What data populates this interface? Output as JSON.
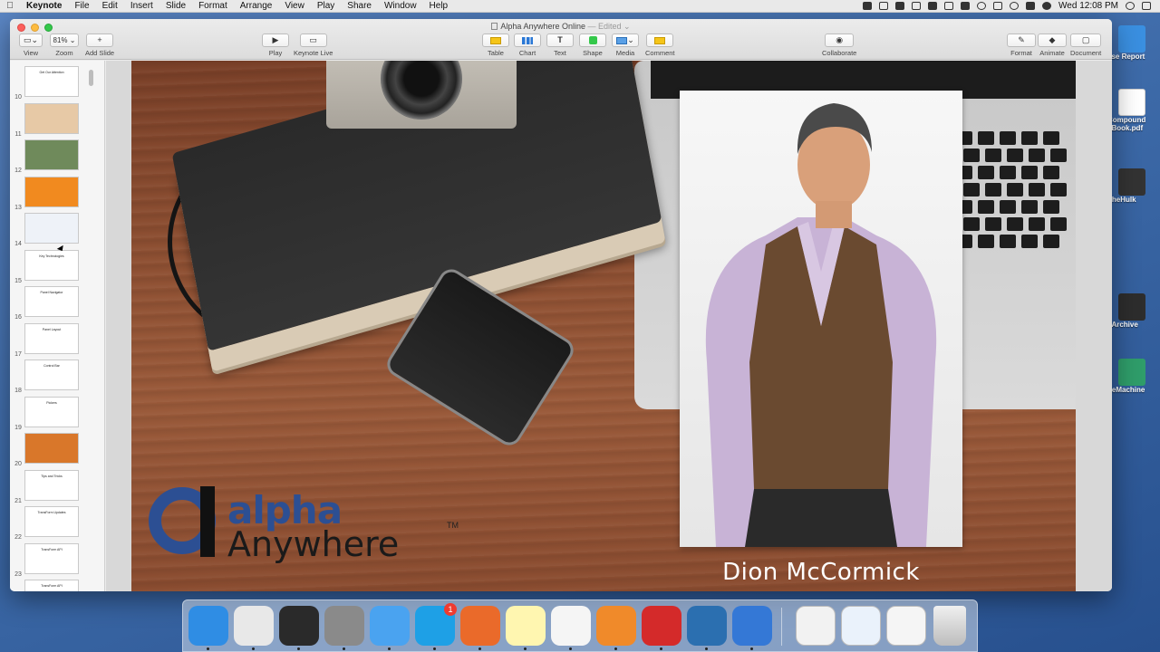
{
  "menubar": {
    "app": "Keynote",
    "items": [
      "File",
      "Edit",
      "Insert",
      "Slide",
      "Format",
      "Arrange",
      "View",
      "Play",
      "Share",
      "Window",
      "Help"
    ],
    "clock": "Wed 12:08 PM"
  },
  "window": {
    "title": "Alpha Anywhere Online",
    "status": "— Edited ⌄"
  },
  "toolbar": {
    "view": "View",
    "zoom_value": "81% ⌄",
    "zoom": "Zoom",
    "add_slide": "Add Slide",
    "play": "Play",
    "keynote_live": "Keynote Live",
    "table": "Table",
    "chart": "Chart",
    "text": "Text",
    "shape": "Shape",
    "media": "Media",
    "comment": "Comment",
    "collaborate": "Collaborate",
    "format": "Format",
    "animate": "Animate",
    "document": "Document"
  },
  "navigator": {
    "slides": [
      {
        "num": "10",
        "title": "Get Our Attention",
        "color": "#ffffff"
      },
      {
        "num": "11",
        "title": "",
        "color": "#e7c9a6"
      },
      {
        "num": "12",
        "title": "",
        "color": "#6f8a5b"
      },
      {
        "num": "13",
        "title": "",
        "color": "#f18a1f"
      },
      {
        "num": "14",
        "title": "",
        "color": "#eef2f8"
      },
      {
        "num": "15",
        "title": "Key Technologies",
        "color": "#ffffff"
      },
      {
        "num": "16",
        "title": "Panel Navigator",
        "color": "#ffffff"
      },
      {
        "num": "17",
        "title": "Panel Layout",
        "color": "#ffffff"
      },
      {
        "num": "18",
        "title": "Control Bar",
        "color": "#ffffff"
      },
      {
        "num": "19",
        "title": "Pickers",
        "color": "#ffffff"
      },
      {
        "num": "20",
        "title": "",
        "color": "#d9772a"
      },
      {
        "num": "21",
        "title": "Tips and Tricks",
        "color": "#ffffff"
      },
      {
        "num": "22",
        "title": "TransForm Updates",
        "color": "#ffffff"
      },
      {
        "num": "23",
        "title": "TransForm API",
        "color": "#ffffff"
      },
      {
        "num": "",
        "title": "TransForm API",
        "color": "#ffffff"
      }
    ]
  },
  "slide": {
    "logo_word1": "alpha",
    "logo_word2": "Anywhere",
    "logo_tm": "TM",
    "caption": "Dion McCormick"
  },
  "desktop": {
    "items": [
      {
        "label": "ase Report"
      },
      {
        "label": "Compound eBook.pdf"
      },
      {
        "label": "TheHulk"
      },
      {
        "label": "kArchive"
      },
      {
        "label": "neMachine"
      }
    ]
  },
  "dock": {
    "apps": [
      {
        "name": "Finder",
        "color": "#2f8de4"
      },
      {
        "name": "Chrome",
        "color": "#e8e8e8"
      },
      {
        "name": "Screen",
        "color": "#2a2a2a"
      },
      {
        "name": "Launchpad",
        "color": "#8a8a8a"
      },
      {
        "name": "Messages",
        "color": "#4aa3f0"
      },
      {
        "name": "Skype",
        "color": "#1ea0e6",
        "badge": "1"
      },
      {
        "name": "Office",
        "color": "#ea6a2a"
      },
      {
        "name": "Notes",
        "color": "#fff6b0"
      },
      {
        "name": "Photos",
        "color": "#f5f5f5"
      },
      {
        "name": "Flower",
        "color": "#f08a2a"
      },
      {
        "name": "Parallels",
        "color": "#d42a2a"
      },
      {
        "name": "S App",
        "color": "#2b6fb0"
      },
      {
        "name": "Keynote",
        "color": "#3478d6"
      }
    ]
  }
}
